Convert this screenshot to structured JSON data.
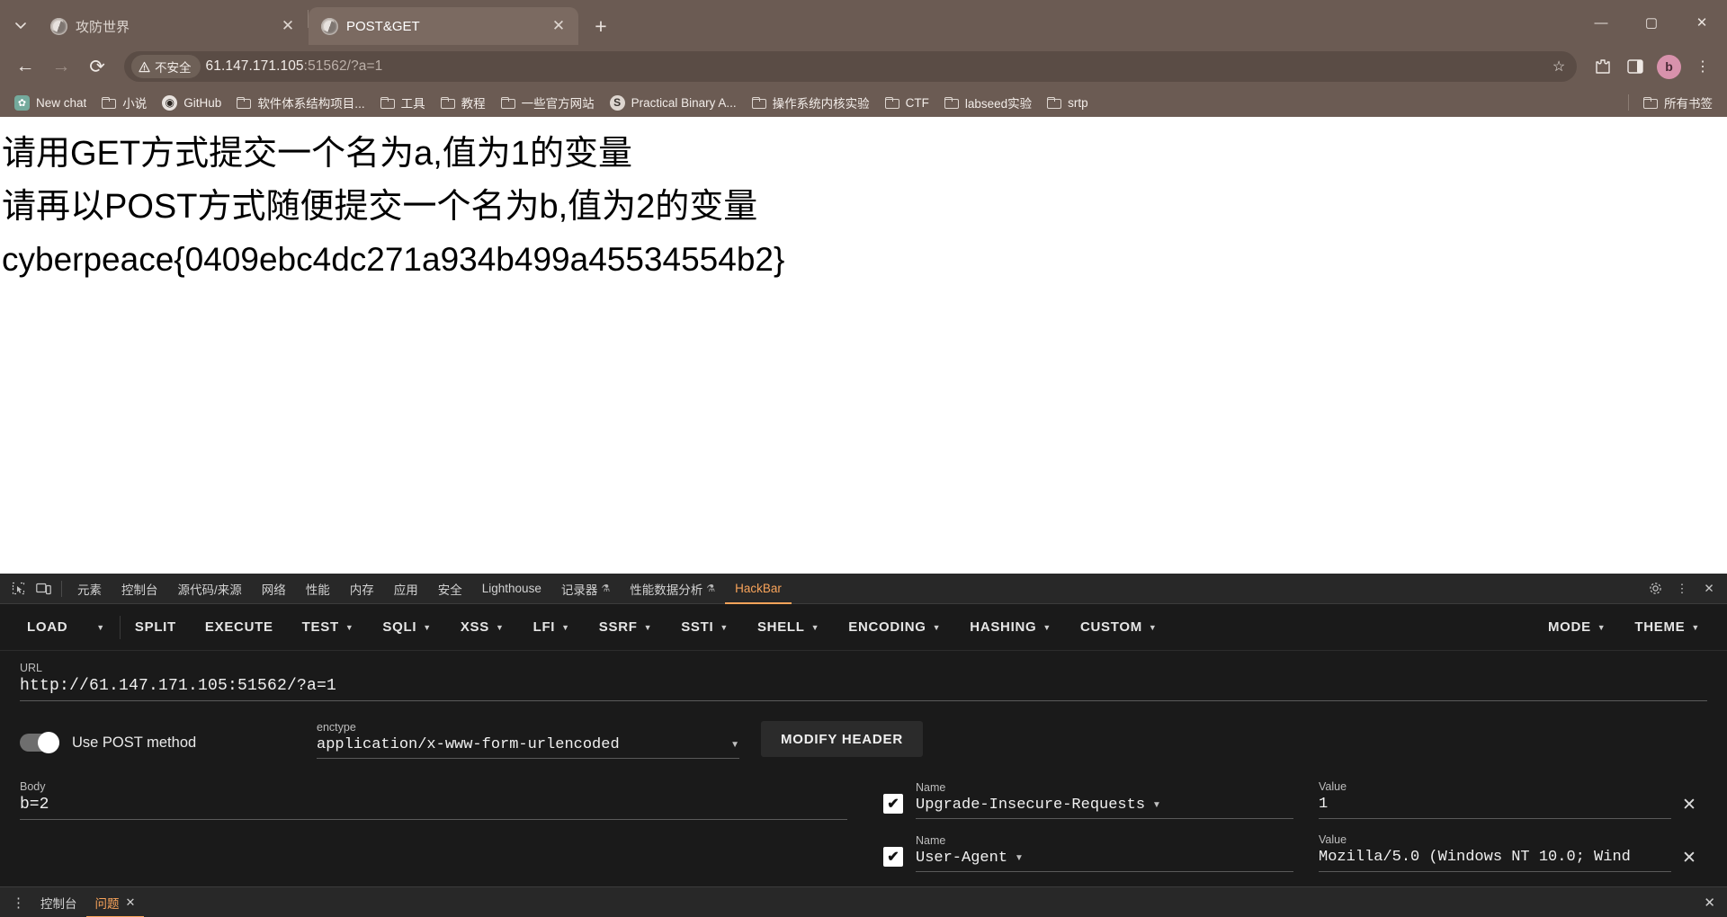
{
  "browser": {
    "tabs": [
      {
        "title": "攻防世界",
        "active": false,
        "close": "✕",
        "favicon": "globe-icon"
      },
      {
        "title": "POST&GET",
        "active": true,
        "close": "✕",
        "favicon": "globe-icon"
      }
    ],
    "tab_search_icon": "⌄",
    "new_tab_label": "+",
    "window_controls": {
      "minimize": "—",
      "maximize": "▢",
      "close": "✕"
    },
    "nav": {
      "back": "←",
      "forward": "→",
      "reload": "⟳"
    },
    "omnibox": {
      "security_label": "不安全",
      "security_icon": "warning-triangle-icon",
      "url_host": "61.147.171.105",
      "url_rest": ":51562/?a=1",
      "star_icon": "☆"
    },
    "toolbar_right": {
      "extensions": "puzzle-icon",
      "sidepanel": "sidepanel-icon",
      "profile_initial": "b",
      "menu": "⋮"
    },
    "bookmarks": [
      {
        "label": "New chat",
        "icon": "chatgpt-icon"
      },
      {
        "label": "小说",
        "icon": "folder-icon"
      },
      {
        "label": "GitHub",
        "icon": "github-icon"
      },
      {
        "label": "软件体系结构项目...",
        "icon": "folder-icon"
      },
      {
        "label": "工具",
        "icon": "folder-icon"
      },
      {
        "label": "教程",
        "icon": "folder-icon"
      },
      {
        "label": "一些官方网站",
        "icon": "folder-icon"
      },
      {
        "label": "Practical Binary A...",
        "icon": "book-icon"
      },
      {
        "label": "操作系统内核实验",
        "icon": "folder-icon"
      },
      {
        "label": "CTF",
        "icon": "folder-icon"
      },
      {
        "label": "labseed实验",
        "icon": "folder-icon"
      },
      {
        "label": "srtp",
        "icon": "folder-icon"
      }
    ],
    "all_bookmarks_label": "所有书签"
  },
  "page": {
    "lines": [
      "请用GET方式提交一个名为a,值为1的变量",
      "请再以POST方式随便提交一个名为b,值为2的变量",
      "cyberpeace{0409ebc4dc271a934b499a45534554b2}"
    ]
  },
  "devtools": {
    "left_icons": [
      "inspect-icon",
      "device-toolbar-icon"
    ],
    "tabs": [
      {
        "label": "元素",
        "active": false
      },
      {
        "label": "控制台",
        "active": false
      },
      {
        "label": "源代码/来源",
        "active": false
      },
      {
        "label": "网络",
        "active": false
      },
      {
        "label": "性能",
        "active": false
      },
      {
        "label": "内存",
        "active": false
      },
      {
        "label": "应用",
        "active": false
      },
      {
        "label": "安全",
        "active": false
      },
      {
        "label": "Lighthouse",
        "active": false
      },
      {
        "label": "记录器",
        "active": false,
        "suffix": "⚗"
      },
      {
        "label": "性能数据分析",
        "active": false,
        "suffix": "⚗"
      },
      {
        "label": "HackBar",
        "active": true
      }
    ],
    "right_icons": [
      "settings-gear-icon",
      "more-vertical-icon",
      "close-icon"
    ]
  },
  "hackbar": {
    "buttons": [
      {
        "label": "LOAD",
        "caret": true,
        "split": true
      },
      {
        "label": "SPLIT",
        "caret": false
      },
      {
        "label": "EXECUTE",
        "caret": false
      },
      {
        "label": "TEST",
        "caret": true
      },
      {
        "label": "SQLI",
        "caret": true
      },
      {
        "label": "XSS",
        "caret": true
      },
      {
        "label": "LFI",
        "caret": true
      },
      {
        "label": "SSRF",
        "caret": true
      },
      {
        "label": "SSTI",
        "caret": true
      },
      {
        "label": "SHELL",
        "caret": true
      },
      {
        "label": "ENCODING",
        "caret": true
      },
      {
        "label": "HASHING",
        "caret": true
      },
      {
        "label": "CUSTOM",
        "caret": true
      }
    ],
    "right_buttons": [
      {
        "label": "MODE",
        "caret": true
      },
      {
        "label": "THEME",
        "caret": true
      }
    ],
    "url_label": "URL",
    "url_value": "http://61.147.171.105:51562/?a=1",
    "post_toggle_label": "Use POST method",
    "post_toggle_on": true,
    "enctype_label": "enctype",
    "enctype_value": "application/x-www-form-urlencoded",
    "modify_header_label": "MODIFY HEADER",
    "body_label": "Body",
    "body_value": "b=2",
    "headers": [
      {
        "checked": "✔",
        "name_label": "Name",
        "name_value": "Upgrade-Insecure-Requests",
        "value_label": "Value",
        "value_value": "1",
        "remove": "✕"
      },
      {
        "checked": "✔",
        "name_label": "Name",
        "name_value": "User-Agent",
        "value_label": "Value",
        "value_value": "Mozilla/5.0 (Windows NT 10.0; Wind",
        "remove": "✕"
      }
    ]
  },
  "drawer": {
    "menu_icon": "⋮",
    "tabs": [
      {
        "label": "控制台",
        "active": false,
        "closable": false
      },
      {
        "label": "问题",
        "active": true,
        "closable": true,
        "close": "✕"
      }
    ],
    "close_icon": "✕"
  }
}
